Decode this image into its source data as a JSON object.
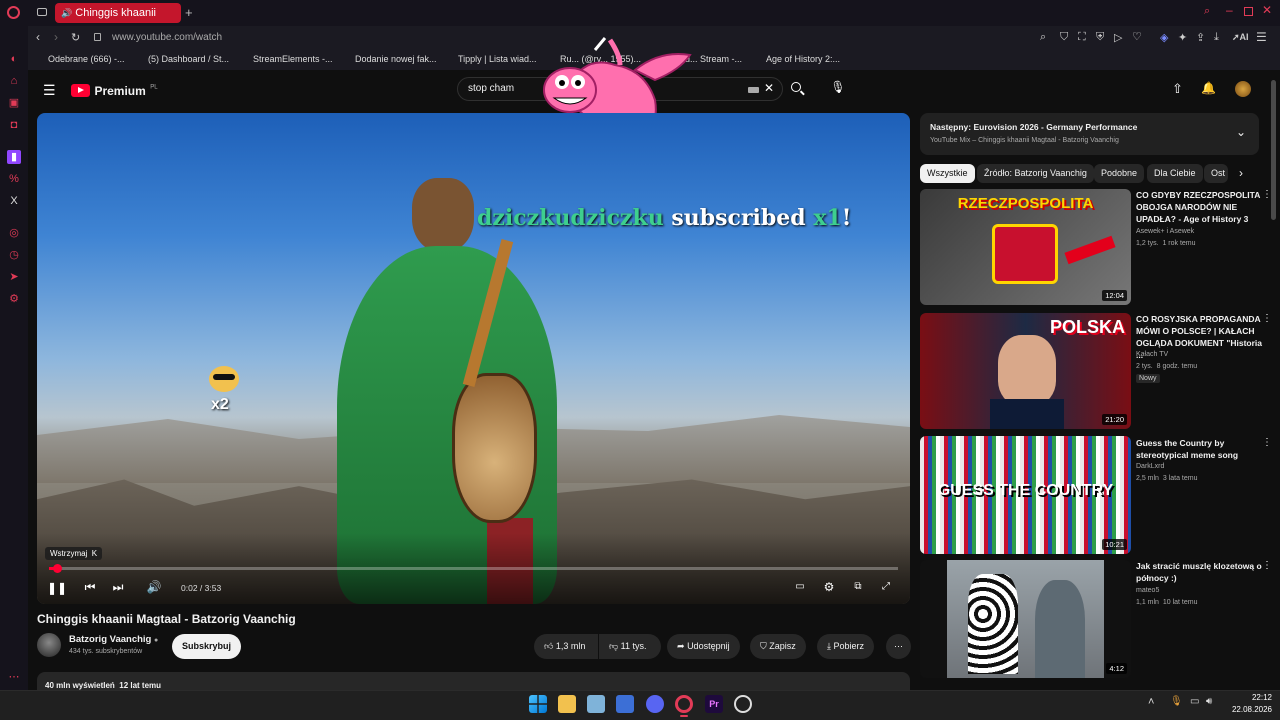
{
  "browser": {
    "tab_title": "Chinggis khaanii Magta",
    "address": "www.youtube.com/watch",
    "bookmarks": [
      "Odebrane (666) -...",
      "(5) Dashboard / St...",
      "StreamElements -...",
      "Dodanie nowej fak...",
      "Tipply | Lista wiad...",
      "Ru... (@rv... 1955)...",
      "uu... Stream -...",
      "Age of History 2:..."
    ]
  },
  "header": {
    "logo": "Premium",
    "logo_sup": "PL",
    "search_value": "stop cham"
  },
  "overlay": {
    "sub_name": "dziczkudziczku",
    "sub_text": "subscribed",
    "sub_count": "x1",
    "sub_bang": "!",
    "multiplier": "x2"
  },
  "player": {
    "tooltip": "Wstrzymaj  K",
    "time": "0:02 / 3:53",
    "progress": 0.01
  },
  "video": {
    "title": "Chinggis khaanii Magtaal - Batzorig Vaanchig",
    "channel": "Batzorig Vaanchig",
    "subscribers": "434 tys. subskrybentów",
    "subscribe_label": "Subskrybuj",
    "likes": "1,3 mln",
    "dislikes": "11 tys.",
    "share": "Udostępnij",
    "save": "Zapisz",
    "download": "Pobierz",
    "views": "40 mln wyświetleń  12 lat temu"
  },
  "up_next": {
    "title": "Następny: Eurovision 2026 - Germany Performance",
    "subtitle": "YouTube Mix – Chinggis khaanii Magtaal - Batzorig Vaanchig"
  },
  "chips": [
    "Wszystkie",
    "Źródło: Batzorig Vaanchig",
    "Podobne",
    "Dla Ciebie",
    "Ost"
  ],
  "recommendations": [
    {
      "title": "CO GDYBY RZECZPOSPOLITA OBOJGA NARODÓW NIE UPADŁA? - Age of History 3",
      "channel": "Asewek+ i Asewek",
      "meta": "1,2 tys.  1 rok temu",
      "duration": "12:04",
      "badge": "",
      "thumb_text": "RZECZPOSPOLITA"
    },
    {
      "title": "CO ROSYJSKA PROPAGANDA MÓWI O POLSCE? | KAŁACH OGLĄDA DOKUMENT \"Historia ...",
      "channel": "Kałach TV",
      "meta": "2 tys.  8 godz. temu",
      "duration": "21:20",
      "badge": "Nowy",
      "thumb_text": "POLSKA"
    },
    {
      "title": "Guess the Country by stereotypical meme song",
      "channel": "DarkLxrd",
      "meta": "2,5 mln  3 lata temu",
      "duration": "10:21",
      "badge": "",
      "thumb_text": "GUESS THE COUNTRY"
    },
    {
      "title": "Jak stracić muszlę klozetową o północy :)",
      "channel": "mateo5",
      "meta": "1,1 mln  10 lat temu",
      "duration": "4:12",
      "badge": "",
      "thumb_text": ""
    }
  ],
  "taskbar": {
    "time": "22:12",
    "date": "22.08.2026"
  },
  "colors": {
    "accent": "#ff0033",
    "opera": "#e23b57",
    "sub_name": "#3ecf8e"
  }
}
